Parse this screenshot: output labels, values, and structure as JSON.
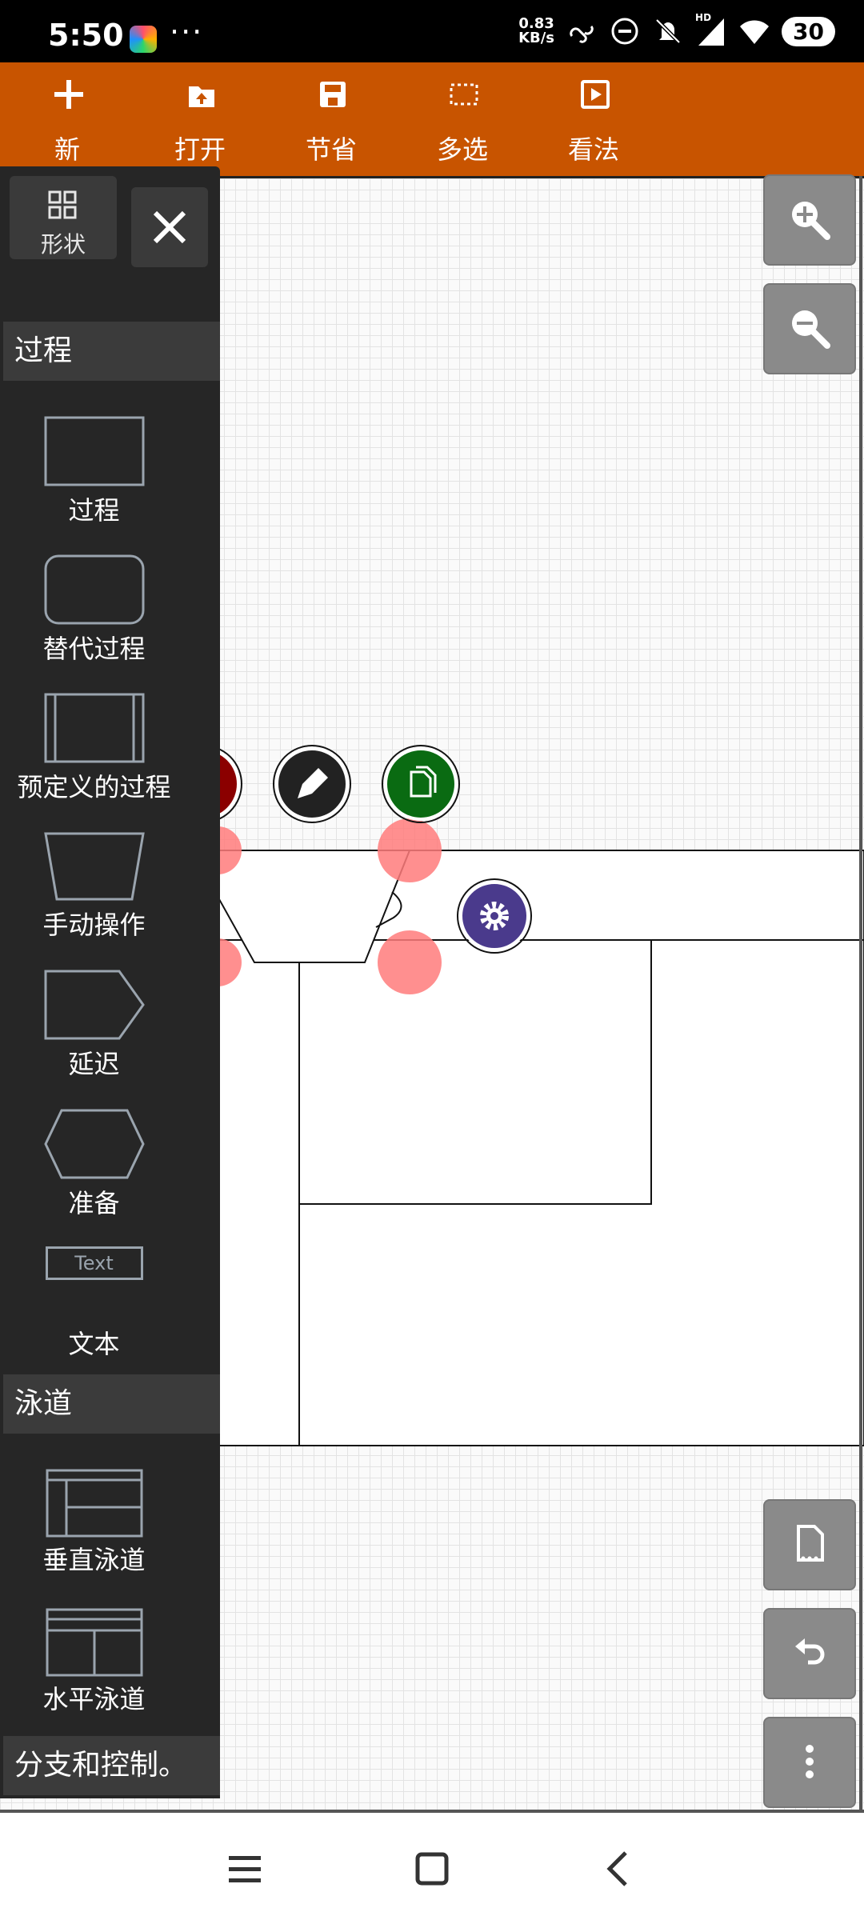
{
  "status_bar": {
    "time": "5:50",
    "dots": "···",
    "net_speed_value": "0.83",
    "net_speed_unit": "KB/s",
    "hd_label": "HD",
    "battery": "30"
  },
  "toolbar": {
    "new_label": "新",
    "open_label": "打开",
    "save_label": "节省",
    "multiselect_label": "多选",
    "view_label": "看法"
  },
  "sidebar": {
    "shapes_tab_label": "形状",
    "sections": [
      {
        "title": "过程",
        "items": [
          {
            "label": "过程"
          },
          {
            "label": "替代过程"
          },
          {
            "label": "预定义的过程"
          },
          {
            "label": "手动操作"
          },
          {
            "label": "延迟"
          },
          {
            "label": "准备"
          },
          {
            "label": "文本",
            "preview_text": "Text"
          }
        ]
      },
      {
        "title": "泳道",
        "items": [
          {
            "label": "垂直泳道"
          },
          {
            "label": "水平泳道"
          }
        ]
      },
      {
        "title": "分支和控制。"
      }
    ]
  },
  "colors": {
    "toolbar": "#c85400",
    "sidebar": "#262626",
    "edit_delete": "#8b0000",
    "edit_pencil": "#222222",
    "edit_copy": "#0a6b12",
    "edit_settings": "#4a3a8c",
    "handle": "#ff7b7b"
  }
}
